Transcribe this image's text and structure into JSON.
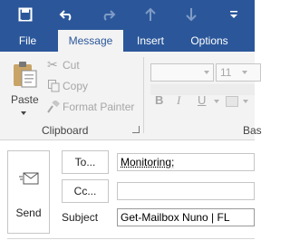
{
  "ribbon_tabs": [
    "File",
    "Message",
    "Insert",
    "Options"
  ],
  "clipboard": {
    "paste_label": "Paste",
    "cut_label": "Cut",
    "copy_label": "Copy",
    "format_painter_label": "Format Painter",
    "group_label": "Clipboard"
  },
  "basic_text": {
    "font_size": "11",
    "bold": "B",
    "italic": "I",
    "underline": "U",
    "group_label": "Bas"
  },
  "compose": {
    "send_label": "Send",
    "to_label": "To...",
    "cc_label": "Cc...",
    "subject_label": "Subject",
    "to_value": "Monitoring;",
    "cc_value": "",
    "subject_value": "Get-Mailbox Nuno | FL"
  },
  "colors": {
    "accent": "#2b579a",
    "ribbon_bg": "#f3f3f3"
  }
}
